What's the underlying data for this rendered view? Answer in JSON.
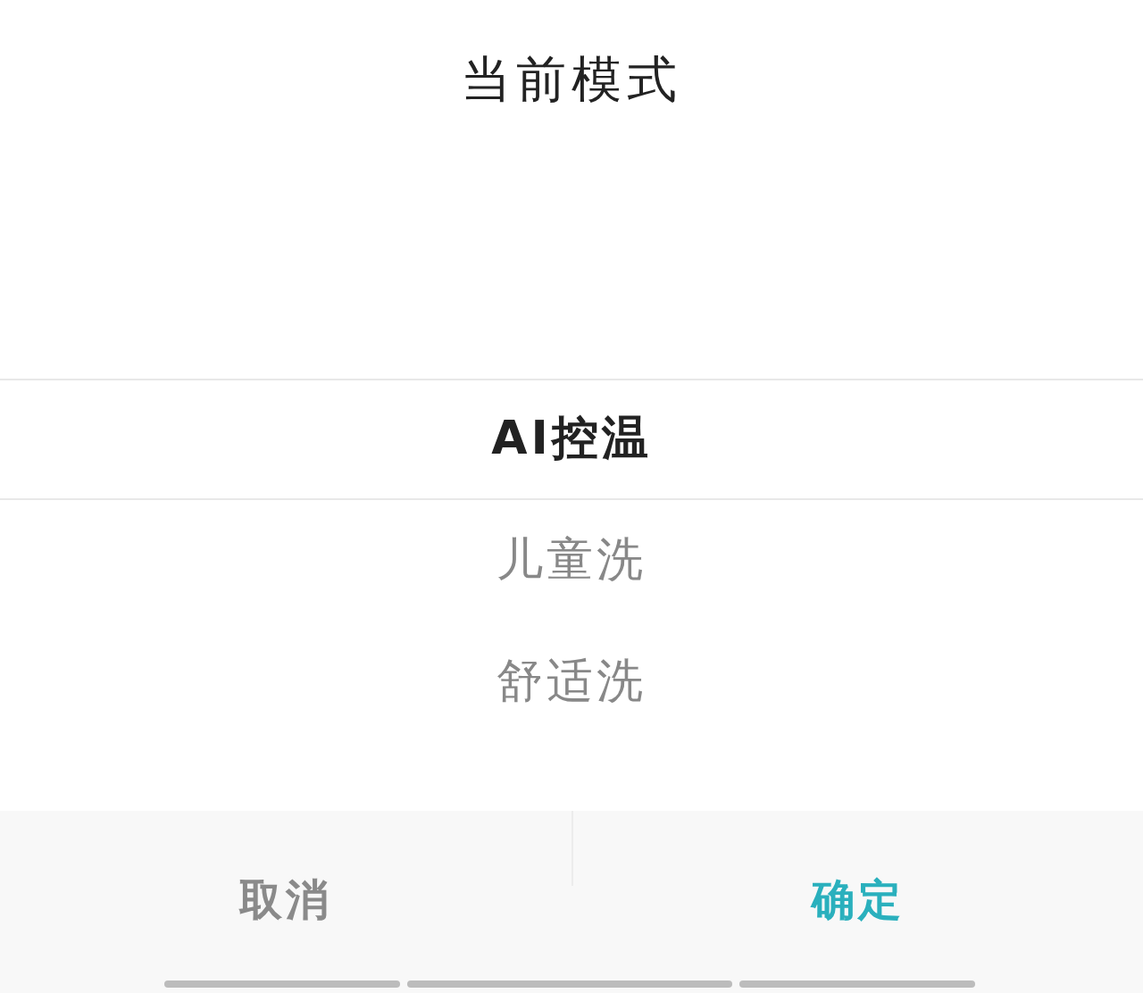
{
  "title": "当前模式",
  "options": [
    {
      "label": "AI控温",
      "selected": true
    },
    {
      "label": "儿童洗",
      "selected": false
    },
    {
      "label": "舒适洗",
      "selected": false
    }
  ],
  "buttons": [
    {
      "label": "取消",
      "kind": "cancel"
    },
    {
      "label": "确定",
      "kind": "confirm"
    }
  ]
}
